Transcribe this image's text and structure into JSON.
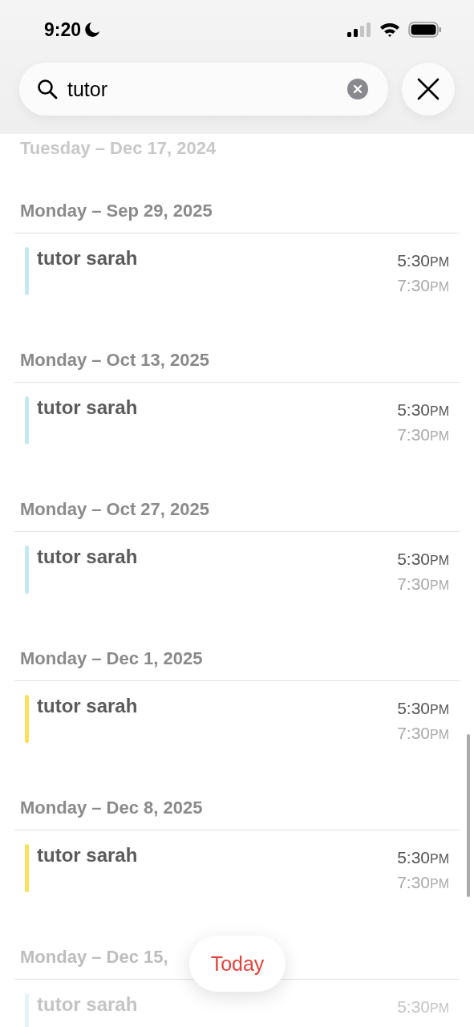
{
  "status_bar": {
    "time": "9:20"
  },
  "search": {
    "value": "tutor"
  },
  "sections": [
    {
      "date": "Tuesday – Dec 17, 2024",
      "faded": true
    },
    {
      "date": "Monday – Sep 29, 2025",
      "faded": false,
      "events": [
        {
          "title": "tutor sarah",
          "color": "#c6e9ef",
          "start": "5:30",
          "start_suffix": "PM",
          "end": "7:30",
          "end_suffix": "PM"
        }
      ]
    },
    {
      "date": "Monday – Oct 13, 2025",
      "faded": false,
      "events": [
        {
          "title": "tutor sarah",
          "color": "#c6e9ef",
          "start": "5:30",
          "start_suffix": "PM",
          "end": "7:30",
          "end_suffix": "PM"
        }
      ]
    },
    {
      "date": "Monday – Oct 27, 2025",
      "faded": false,
      "events": [
        {
          "title": "tutor sarah",
          "color": "#c6e9ef",
          "start": "5:30",
          "start_suffix": "PM",
          "end": "7:30",
          "end_suffix": "PM"
        }
      ]
    },
    {
      "date": "Monday – Dec 1, 2025",
      "faded": false,
      "events": [
        {
          "title": "tutor sarah",
          "color": "#fbe05a",
          "start": "5:30",
          "start_suffix": "PM",
          "end": "7:30",
          "end_suffix": "PM"
        }
      ]
    },
    {
      "date": "Monday – Dec 8, 2025",
      "faded": false,
      "events": [
        {
          "title": "tutor sarah",
          "color": "#fbe05a",
          "start": "5:30",
          "start_suffix": "PM",
          "end": "7:30",
          "end_suffix": "PM"
        }
      ]
    },
    {
      "date": "Monday – Dec 15,",
      "faded": true,
      "events": [
        {
          "title": "tutor sarah",
          "color": "#e3f4f7",
          "start": "5:30",
          "start_suffix": "PM"
        }
      ]
    }
  ],
  "today_button": {
    "label": "Today"
  }
}
